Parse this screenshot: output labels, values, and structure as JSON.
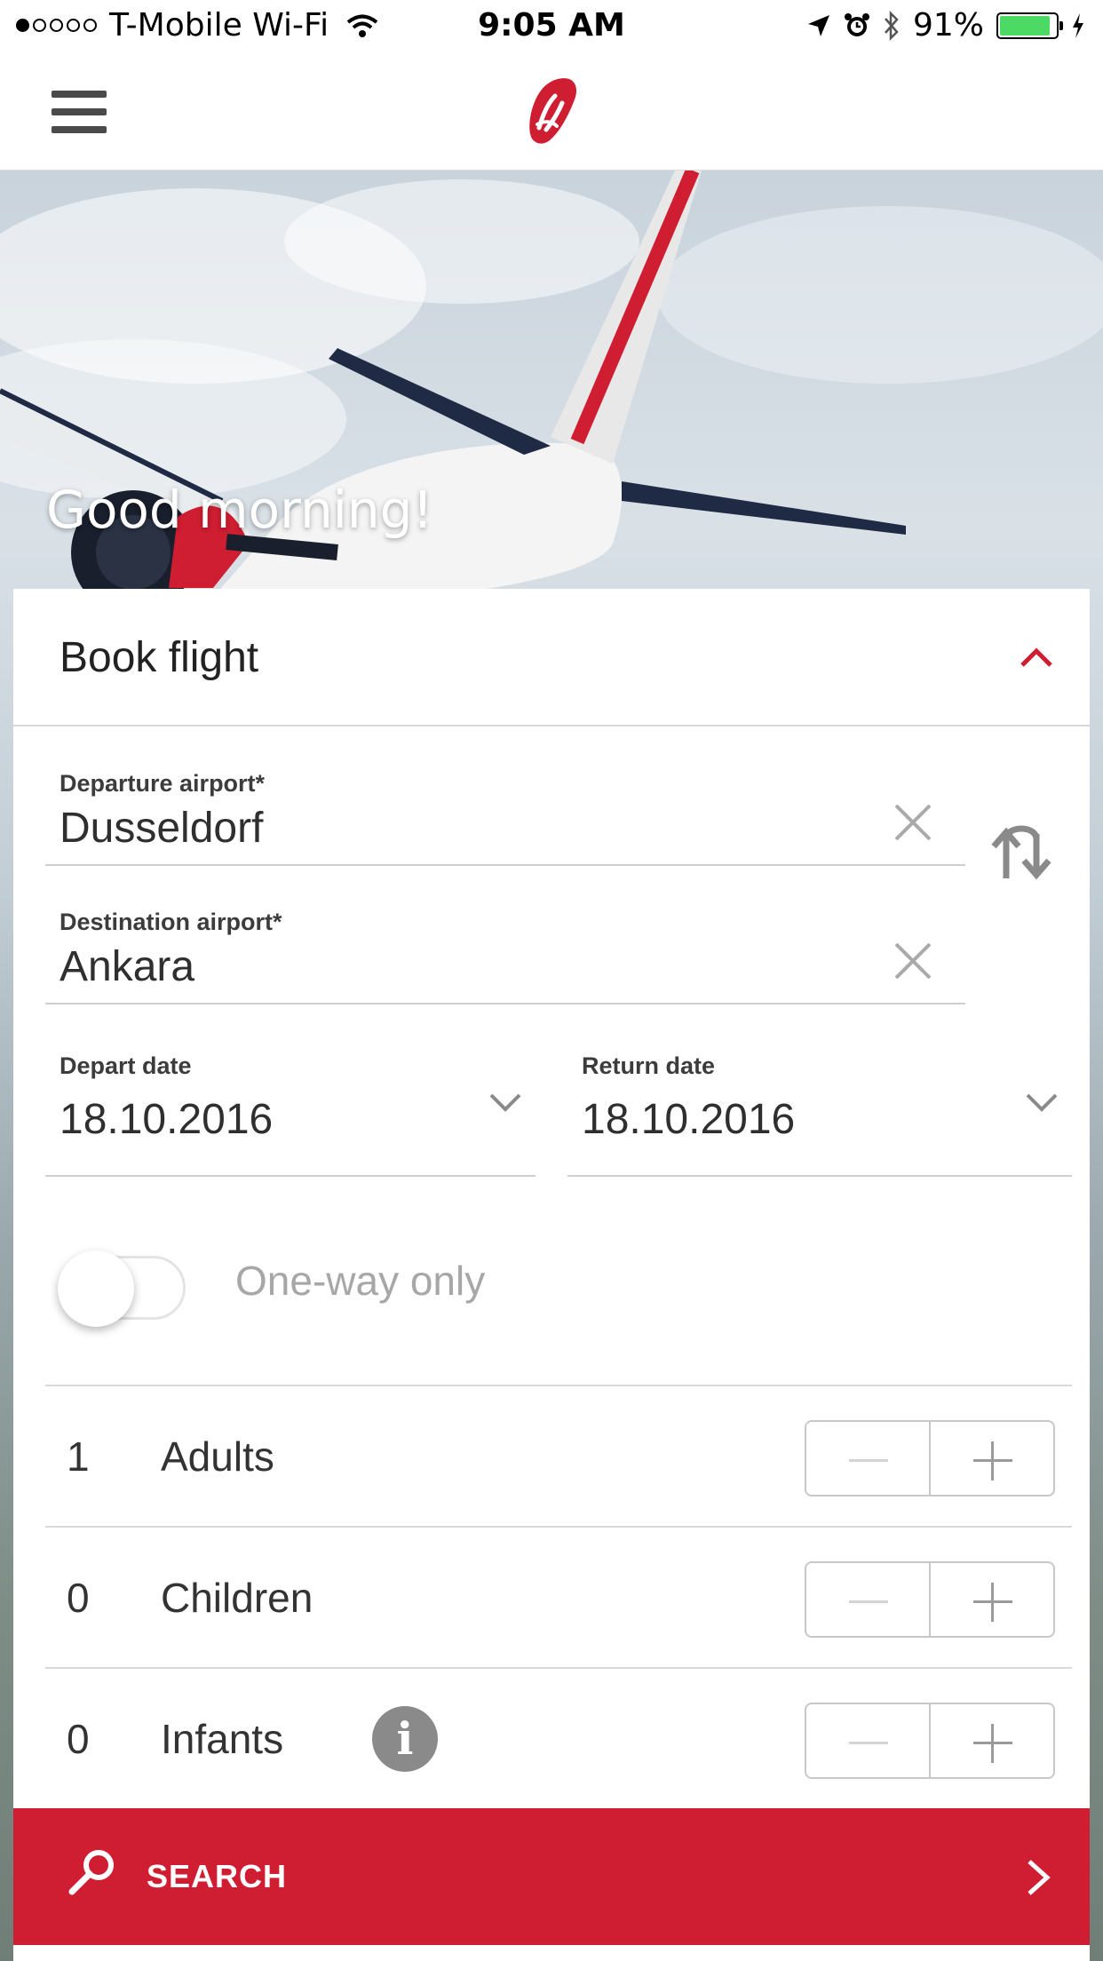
{
  "status_bar": {
    "carrier": "T-Mobile Wi-Fi",
    "time": "9:05 AM",
    "battery": "91%",
    "battery_level": 0.91,
    "signal_bars": 1,
    "signal_total": 5
  },
  "nav": {
    "menu_icon": "hamburger-icon",
    "logo_icon": "airberlin-logo"
  },
  "hero": {
    "greeting": "Good morning!"
  },
  "booking": {
    "title": "Book flight",
    "departure": {
      "label": "Departure airport*",
      "value": "Dusseldorf"
    },
    "destination": {
      "label": "Destination airport*",
      "value": "Ankara"
    },
    "depart_date": {
      "label": "Depart date",
      "value": "18.10.2016"
    },
    "return_date": {
      "label": "Return date",
      "value": "18.10.2016"
    },
    "one_way": {
      "label": "One-way only",
      "on": false
    },
    "passengers": [
      {
        "count": "1",
        "label": "Adults",
        "info": false
      },
      {
        "count": "0",
        "label": "Children",
        "info": false
      },
      {
        "count": "0",
        "label": "Infants",
        "info": true
      }
    ],
    "info_glyph": "i",
    "search_label": "SEARCH"
  },
  "colors": {
    "brand_red": "#cf1e31",
    "battery_green": "#4cd964"
  }
}
